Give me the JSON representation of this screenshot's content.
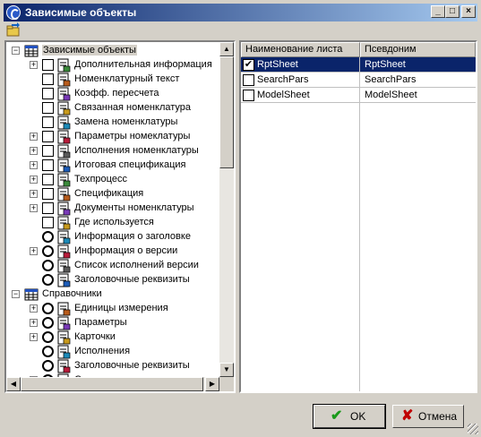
{
  "window": {
    "title": "Зависимые объекты"
  },
  "title_buttons": {
    "minimize": "_",
    "maximize": "□",
    "close": "×"
  },
  "tree": {
    "items": [
      {
        "label": "Зависимые объекты",
        "level": 0,
        "expander": "-",
        "check": "none",
        "icon": "table-icon",
        "selected": true
      },
      {
        "label": "Дополнительная информация",
        "level": 1,
        "expander": "+",
        "check": "box",
        "icon": "document-icon"
      },
      {
        "label": "Номенклатурный текст",
        "level": 1,
        "expander": "",
        "check": "box",
        "icon": "text-doc-icon"
      },
      {
        "label": "Коэфф. пересчета",
        "level": 1,
        "expander": "",
        "check": "box",
        "icon": "coefficient-icon"
      },
      {
        "label": "Связанная номенклатура",
        "level": 1,
        "expander": "",
        "check": "box",
        "icon": "linked-icon"
      },
      {
        "label": "Замена номенклатуры",
        "level": 1,
        "expander": "",
        "check": "box",
        "icon": "swap-icon"
      },
      {
        "label": "Параметры номеклатуры",
        "level": 1,
        "expander": "+",
        "check": "box",
        "icon": "params-icon"
      },
      {
        "label": "Исполнения номенклатуры",
        "level": 1,
        "expander": "+",
        "check": "box",
        "icon": "variants-icon"
      },
      {
        "label": "Итоговая спецификация",
        "level": 1,
        "expander": "+",
        "check": "box",
        "icon": "spec-total-icon"
      },
      {
        "label": "Техпроцесс",
        "level": 1,
        "expander": "+",
        "check": "box",
        "icon": "process-icon"
      },
      {
        "label": "Спецификация",
        "level": 1,
        "expander": "+",
        "check": "box",
        "icon": "spec-icon"
      },
      {
        "label": "Документы номенклатуры",
        "level": 1,
        "expander": "+",
        "check": "box",
        "icon": "docs-icon"
      },
      {
        "label": "Где используется",
        "level": 1,
        "expander": "",
        "check": "box",
        "icon": "where-used-icon"
      },
      {
        "label": "Информация о заголовке",
        "level": 1,
        "expander": "",
        "check": "circle",
        "icon": "header-info-icon"
      },
      {
        "label": "Информация о версии",
        "level": 1,
        "expander": "+",
        "check": "circle",
        "icon": "version-icon"
      },
      {
        "label": "Список исполнений версии",
        "level": 1,
        "expander": "",
        "check": "circle",
        "icon": "version-list-icon"
      },
      {
        "label": "Заголовочные реквизиты",
        "level": 1,
        "expander": "",
        "check": "circle",
        "icon": "header-attr-icon"
      },
      {
        "label": "Справочники",
        "level": 0,
        "expander": "-",
        "check": "none",
        "icon": "table-icon"
      },
      {
        "label": "Единицы измерения",
        "level": 1,
        "expander": "+",
        "check": "circle",
        "icon": "units-icon"
      },
      {
        "label": "Параметры",
        "level": 1,
        "expander": "+",
        "check": "circle",
        "icon": "parameters-icon"
      },
      {
        "label": "Карточки",
        "level": 1,
        "expander": "+",
        "check": "circle",
        "icon": "cards-icon"
      },
      {
        "label": "Исполнения",
        "level": 1,
        "expander": "",
        "check": "circle",
        "icon": "variants2-icon"
      },
      {
        "label": "Заголовочные реквизиты",
        "level": 1,
        "expander": "",
        "check": "circle",
        "icon": "header-attr2-icon"
      },
      {
        "label": "Степень механизации",
        "level": 1,
        "expander": "+",
        "check": "circle",
        "icon": "mechanization-icon"
      }
    ]
  },
  "grid": {
    "columns": [
      "Наименование листа",
      "Псевдоним"
    ],
    "rows": [
      {
        "name": "RptSheet",
        "alias": "RptSheet",
        "checked": true,
        "selected": true
      },
      {
        "name": "SearchPars",
        "alias": "SearchPars",
        "checked": false,
        "selected": false
      },
      {
        "name": "ModelSheet",
        "alias": "ModelSheet",
        "checked": false,
        "selected": false
      }
    ]
  },
  "buttons": {
    "ok": "OK",
    "cancel": "Отмена"
  },
  "colors": {
    "selection": "#0a246a",
    "face": "#d4d0c8",
    "ok_check": "#1a9a1a",
    "cancel_x": "#c00000"
  }
}
